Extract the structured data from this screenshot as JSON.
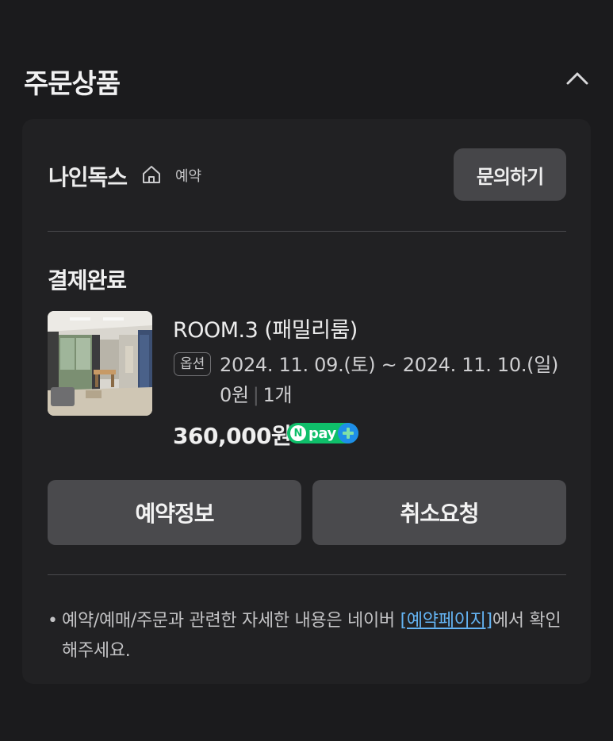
{
  "section": {
    "title": "주문상품"
  },
  "store": {
    "name": "나인독스",
    "tag": "예약",
    "inquiry_label": "문의하기"
  },
  "order": {
    "status": "결제완료",
    "product_name": "ROOM.3 (패밀리룸)",
    "option_badge": "옵션",
    "option_text": "2024. 11. 09.(토) ~ 2024. 11. 10.(일) 0원",
    "quantity": "1개",
    "price": "360,000원",
    "pay_badge": {
      "n": "N",
      "text": "pay"
    }
  },
  "actions": {
    "reservation_info": "예약정보",
    "cancel_request": "취소요청"
  },
  "notice": {
    "bullet": "•",
    "before_link": "예약/예매/주문과 관련한 자세한 내용은 네이버 ",
    "link_text": "[예약페이지]",
    "after_link": "에서 확인해주세요."
  },
  "colors": {
    "background": "#1b1b1d",
    "card": "#212123",
    "button": "#4a4a4d",
    "link": "#64b4f4",
    "npay_green": "#0fbf6a",
    "npay_plus": "#1e8ee8"
  }
}
